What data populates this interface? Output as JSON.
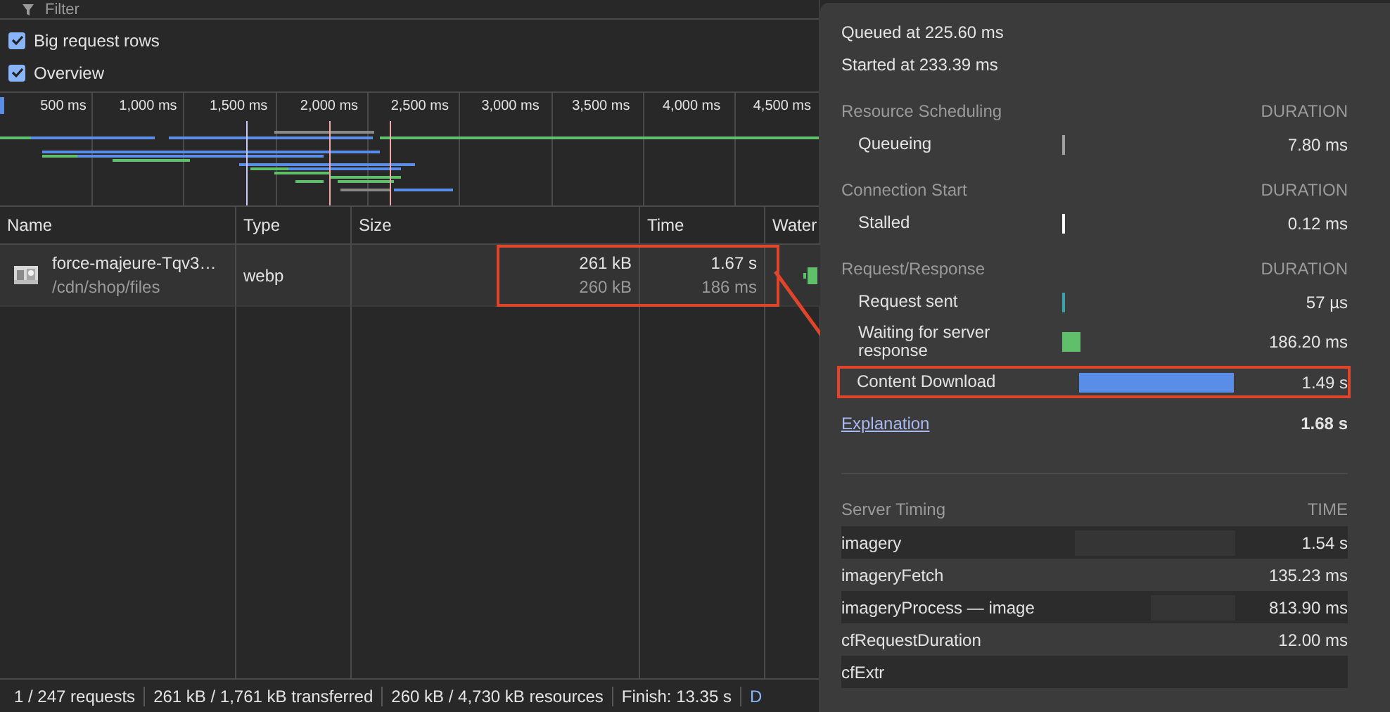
{
  "filter": {
    "placeholder": "Filter"
  },
  "options": [
    {
      "label": "Big request rows",
      "checked": true
    },
    {
      "label": "Overview",
      "checked": true
    }
  ],
  "overview": {
    "ticks": [
      "500 ms",
      "1,000 ms",
      "1,500 ms",
      "2,000 ms",
      "2,500 ms",
      "3,000 ms",
      "3,500 ms",
      "4,000 ms",
      "4,500 ms"
    ]
  },
  "table": {
    "columns": [
      "Name",
      "Type",
      "Size",
      "Time",
      "Water"
    ],
    "rows": [
      {
        "name": "force-majeure-Tqv3…",
        "path": "/cdn/shop/files",
        "type": "webp",
        "size": "261 kB",
        "resource_size": "260 kB",
        "time": "1.67 s",
        "latency": "186 ms",
        "highlighted": true
      }
    ]
  },
  "status_bar": [
    "1 / 247 requests",
    "261 kB / 1,761 kB transferred",
    "260 kB / 4,730 kB resources",
    "Finish: 13.35 s",
    "D"
  ],
  "timing": {
    "queued": "Queued at 225.60 ms",
    "started": "Started at 233.39 ms",
    "sections": [
      {
        "title": "Resource Scheduling",
        "column": "DURATION",
        "phases": [
          {
            "label": "Queueing",
            "value": "7.80 ms",
            "color": "#a0a0a0"
          }
        ]
      },
      {
        "title": "Connection Start",
        "column": "DURATION",
        "phases": [
          {
            "label": "Stalled",
            "value": "0.12 ms",
            "color": "#ffffff"
          }
        ]
      },
      {
        "title": "Request/Response",
        "column": "DURATION",
        "phases": [
          {
            "label": "Request sent",
            "value": "57 µs",
            "color": "#3aa3a8"
          },
          {
            "label": "Waiting for server response",
            "value": "186.20 ms",
            "color": "#5fbf6a"
          },
          {
            "label": "Content Download",
            "value": "1.49 s",
            "color": "#5a8de8",
            "highlighted": true
          }
        ]
      }
    ],
    "explanation": "Explanation",
    "total": "1.68 s",
    "server_timing": {
      "title": "Server Timing",
      "column": "TIME",
      "rows": [
        {
          "name": "imagery",
          "time": "1.54 s"
        },
        {
          "name": "imageryFetch",
          "time": "135.23 ms"
        },
        {
          "name": "imageryProcess — image",
          "time": "813.90 ms"
        },
        {
          "name": "cfRequestDuration",
          "time": "12.00 ms"
        },
        {
          "name": "cfExtr"
        }
      ]
    }
  }
}
